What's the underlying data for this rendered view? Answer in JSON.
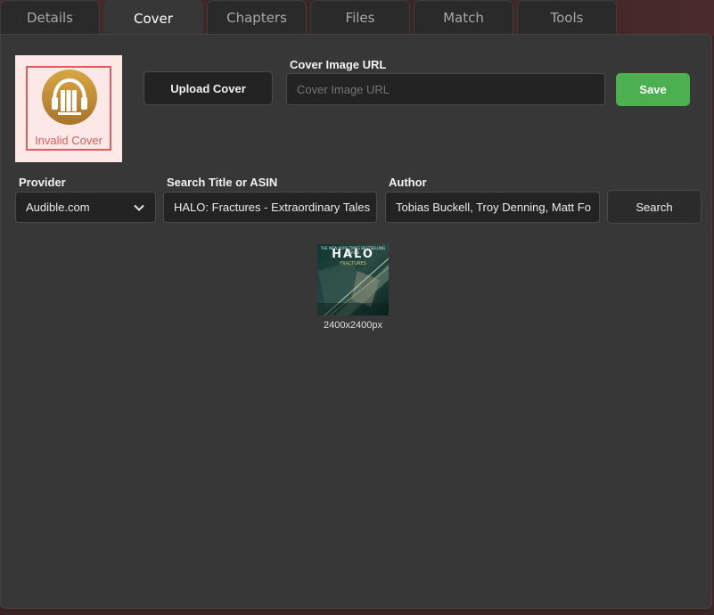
{
  "tabs": [
    {
      "label": "Details"
    },
    {
      "label": "Cover"
    },
    {
      "label": "Chapters"
    },
    {
      "label": "Files"
    },
    {
      "label": "Match"
    },
    {
      "label": "Tools"
    }
  ],
  "active_tab": "Cover",
  "cover": {
    "invalid_text": "Invalid Cover",
    "upload_label": "Upload Cover",
    "url_label": "Cover Image URL",
    "url_placeholder": "Cover Image URL",
    "save_label": "Save"
  },
  "search": {
    "provider_label": "Provider",
    "provider_value": "Audible.com",
    "title_label": "Search Title or ASIN",
    "title_value": "HALO: Fractures - Extraordinary Tales",
    "author_label": "Author",
    "author_value": "Tobias Buckell, Troy Denning, Matt Fo",
    "search_label": "Search"
  },
  "results": [
    {
      "thumb_header": "THE NEW YORK TIMES BESTSELLING SERIES",
      "thumb_title": "HALO",
      "thumb_subtitle": "FRACTURES",
      "size": "2400x2400px"
    }
  ],
  "colors": {
    "accent_save": "#4caf50",
    "invalid": "#e25c5c",
    "panel": "#373737",
    "input_bg": "#232323"
  }
}
